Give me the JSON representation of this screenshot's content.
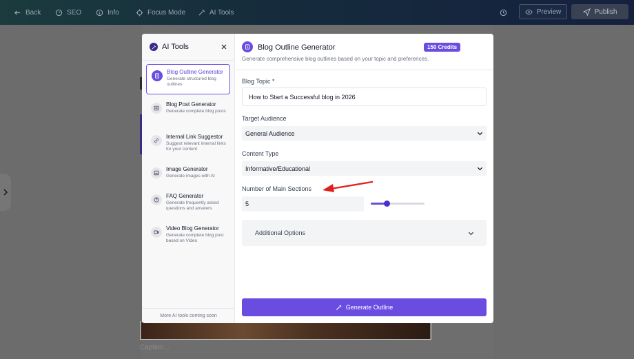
{
  "topbar": {
    "back": "Back",
    "seo": "SEO",
    "info": "Info",
    "focus": "Focus Mode",
    "ai_tools": "AI Tools",
    "preview": "Preview",
    "publish": "Publish"
  },
  "background": {
    "caption": "Caption..."
  },
  "sidebar": {
    "title": "AI Tools",
    "footer": "More AI tools coming soon",
    "items": [
      {
        "name": "Blog Outline Generator",
        "desc": "Generate structured blog outlines",
        "icon": "document-icon",
        "active": true
      },
      {
        "name": "Blog Post Generator",
        "desc": "Generate complete blog posts",
        "icon": "article-icon",
        "active": false
      },
      {
        "name": "Internal Link Suggestor",
        "desc": "Suggest relevant internal links for your content",
        "icon": "link-icon",
        "active": false
      },
      {
        "name": "Image Generator",
        "desc": "Generate images with AI",
        "icon": "image-icon",
        "active": false
      },
      {
        "name": "FAQ Generator",
        "desc": "Generate frequently asked questions and answers",
        "icon": "question-icon",
        "active": false
      },
      {
        "name": "Video Blog Generator",
        "desc": "Generate complete blog post based on Video",
        "icon": "video-icon",
        "active": false
      }
    ]
  },
  "main": {
    "title": "Blog Outline Generator",
    "credits": "150 Credits",
    "subtitle": "Generate comprehensive blog outlines based on your topic and preferences.",
    "topic_label": "Blog Topic *",
    "topic_value": "How to Start a Successful blog in 2026",
    "audience_label": "Target Audience",
    "audience_value": "General Audience",
    "content_label": "Content Type",
    "content_value": "Informative/Educational",
    "sections_label": "Number of Main Sections",
    "sections_value": "5",
    "slider_fraction": 0.3,
    "additional": "Additional Options",
    "generate": "Generate Outline"
  },
  "colors": {
    "accent": "#6a4de0",
    "annotation_arrow": "#e0201f"
  }
}
